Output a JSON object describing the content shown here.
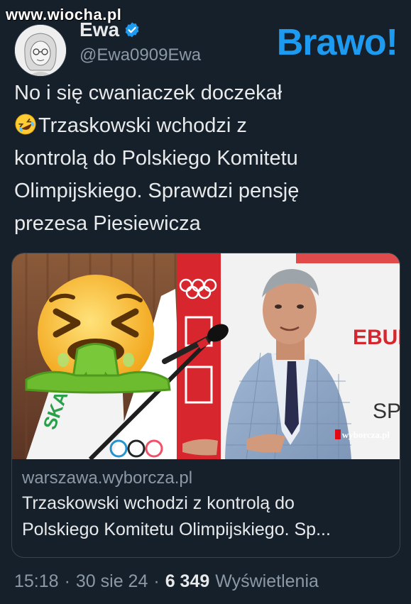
{
  "watermark": "www.wiocha.pl",
  "author": {
    "display_name": "Ewa",
    "handle": "@Ewa0909Ewa"
  },
  "overlay_caption": "Brawo!",
  "tweet": {
    "line1": "No i się cwaniaczek doczekał",
    "line2": "Trzaskowski wchodzi z",
    "line3": "kontrolą do Polskiego Komitetu",
    "line4": "Olimpijskiego. Sprawdzi pensję",
    "line5": "prezesa Piesiewicza",
    "emoji": "rolling-on-floor-laughing-emoji"
  },
  "card": {
    "domain": "warszawa.wyborcza.pl",
    "title_line1": "Trzaskowski wchodzi z kontrolą do",
    "title_line2": "Polskiego Komitetu Olimpijskiego. Sp...",
    "image_credit": "wyborcza.pl",
    "sign_text1": "EBUD",
    "sign_text2": "SPO",
    "flag_text": "SKA"
  },
  "meta": {
    "time": "15:18",
    "separator": "·",
    "date": "30 sie 24",
    "views_count": "6 349",
    "views_label": "Wyświetlenia"
  },
  "colors": {
    "background": "#15202b",
    "accent": "#1d9bf0",
    "text": "#e7e9ea",
    "muted": "#8b98a5"
  }
}
